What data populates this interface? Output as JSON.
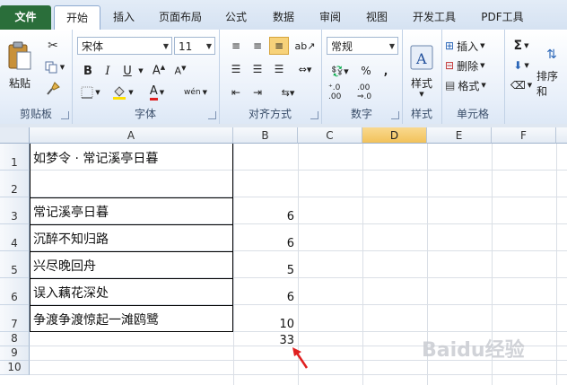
{
  "tabs": [
    "文件",
    "开始",
    "插入",
    "页面布局",
    "公式",
    "数据",
    "审阅",
    "视图",
    "开发工具",
    "PDF工具"
  ],
  "ribbon": {
    "clipboard": {
      "label": "剪贴板",
      "paste": "粘贴"
    },
    "font": {
      "label": "字体",
      "name": "宋体",
      "size": "11",
      "bold": "B",
      "italic": "I",
      "underline": "U",
      "phonetic": "wén",
      "color_red": "#e02020",
      "highlight": "#ffe000"
    },
    "alignment": {
      "label": "对齐方式"
    },
    "number": {
      "label": "数字",
      "format": "常规"
    },
    "styles": {
      "label": "样式",
      "btn": "样式"
    },
    "cells": {
      "label": "单元格",
      "insert": "插入",
      "delete": "删除",
      "format": "格式"
    },
    "editing": {
      "sum": "Σ",
      "sort": "排序和"
    }
  },
  "columns": [
    "A",
    "B",
    "C",
    "D",
    "E",
    "F"
  ],
  "rows": [
    "1",
    "2",
    "3",
    "4",
    "5",
    "6",
    "7",
    "8",
    "9",
    "10"
  ],
  "cells": {
    "A1": "如梦令 · 常记溪亭日暮",
    "A3": "常记溪亭日暮",
    "A4": "沉醉不知归路",
    "A5": "兴尽晚回舟",
    "A6": "误入藕花深处",
    "A7": "争渡争渡惊起一滩鸥鹭",
    "B3": "6",
    "B4": "6",
    "B5": "5",
    "B6": "6",
    "B7": "10",
    "B8": "33"
  },
  "watermark": "Baidu经验",
  "annotation_arrow_color": "#e02020",
  "selected_column": "D"
}
